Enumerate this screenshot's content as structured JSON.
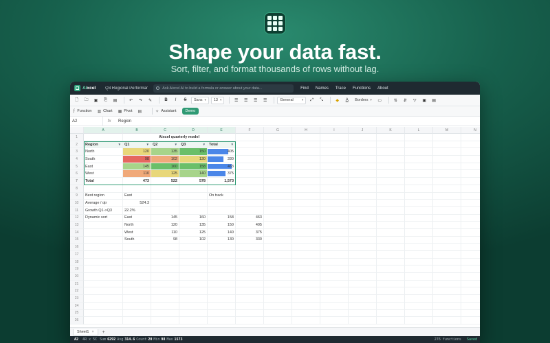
{
  "hero": {
    "headline": "Shape your data fast.",
    "subline": "Sort, filter, and format thousands of rows without lag."
  },
  "titlebar": {
    "app_name_prefix": "Ai",
    "app_name_suffix": "xcel",
    "doc_title": "Q3 Regional Performanc",
    "search_placeholder": "Ask Aixcel AI to build a formula or answer about your data...",
    "menu": [
      "Find",
      "Names",
      "Trace",
      "Functions",
      "About"
    ]
  },
  "toolbar": {
    "font_name": "Sans",
    "font_size": "13",
    "number_format": "General",
    "borders_label": "Borders",
    "bold": "B",
    "italic": "I",
    "strike": "S"
  },
  "toolbar2": {
    "function_label": "Function",
    "chart_label": "Chart",
    "pivot_label": "Pivot",
    "assistant_label": "Assistant",
    "demo_label": "Demo"
  },
  "formula_bar": {
    "cell_ref": "A2",
    "fx": "fx",
    "content": "Region"
  },
  "columns": [
    "A",
    "B",
    "C",
    "D",
    "E",
    "F",
    "G",
    "H",
    "I",
    "J",
    "K",
    "L",
    "M",
    "N"
  ],
  "sheet": {
    "title": "Aixcel quarterly model",
    "headers": [
      "Region",
      "Q1",
      "Q2",
      "Q3",
      "Total"
    ],
    "regions": [
      {
        "name": "North",
        "q1": "120",
        "q2": "135",
        "q3": "150",
        "total": "405",
        "total_fraction": 0.85
      },
      {
        "name": "South",
        "q1": "98",
        "q2": "102",
        "q3": "130",
        "total": "330",
        "total_fraction": 0.65
      },
      {
        "name": "East",
        "q1": "145",
        "q2": "160",
        "q3": "158",
        "total": "463",
        "total_fraction": 1.0
      },
      {
        "name": "West",
        "q1": "110",
        "q2": "125",
        "q3": "140",
        "total": "375",
        "total_fraction": 0.75
      }
    ],
    "total_row": {
      "label": "Total",
      "q1": "473",
      "q2": "522",
      "q3": "578",
      "total": "1,573"
    },
    "best_region_label": "Best region",
    "best_region_value": "East",
    "on_track": "On track",
    "avg_label": "Average / qtr",
    "avg_value": "524.3",
    "growth_label": "Growth Q1->Q3",
    "growth_value": "22.2%",
    "dynamic_sort_label": "Dynamic sort",
    "sorted": [
      {
        "name": "East",
        "q1": "145",
        "q2": "160",
        "q3": "158",
        "total": "463"
      },
      {
        "name": "North",
        "q1": "120",
        "q2": "135",
        "q3": "150",
        "total": "405"
      },
      {
        "name": "West",
        "q1": "110",
        "q2": "125",
        "q3": "140",
        "total": "375"
      },
      {
        "name": "South",
        "q1": "98",
        "q2": "102",
        "q3": "130",
        "total": "330"
      }
    ]
  },
  "heat_colors": {
    "high": "#6abf69",
    "mid_high": "#a7d48a",
    "mid": "#e8d77a",
    "mid_low": "#f0a97a",
    "low": "#e5675f",
    "bar": "#4a86e8",
    "accent": "#2f9a74"
  },
  "sheet_tab": "Sheet1",
  "status": {
    "cell": "A2",
    "mode": "4R x 5C",
    "sum_label": "Sum",
    "sum_value": "6292",
    "avg_label": "Avg",
    "avg_value": "314.6",
    "count_label": "Count",
    "count_value": "20",
    "min_label": "Min",
    "min_value": "98",
    "max_label": "Max",
    "max_value": "1573",
    "functions": "276 functions",
    "saved": "Saved"
  }
}
